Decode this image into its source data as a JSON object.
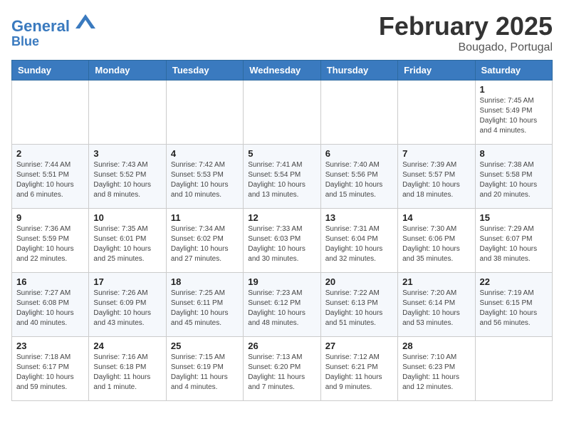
{
  "header": {
    "logo_line1": "General",
    "logo_line2": "Blue",
    "title": "February 2025",
    "subtitle": "Bougado, Portugal"
  },
  "weekdays": [
    "Sunday",
    "Monday",
    "Tuesday",
    "Wednesday",
    "Thursday",
    "Friday",
    "Saturday"
  ],
  "weeks": [
    [
      {
        "day": "",
        "info": ""
      },
      {
        "day": "",
        "info": ""
      },
      {
        "day": "",
        "info": ""
      },
      {
        "day": "",
        "info": ""
      },
      {
        "day": "",
        "info": ""
      },
      {
        "day": "",
        "info": ""
      },
      {
        "day": "1",
        "info": "Sunrise: 7:45 AM\nSunset: 5:49 PM\nDaylight: 10 hours and 4 minutes."
      }
    ],
    [
      {
        "day": "2",
        "info": "Sunrise: 7:44 AM\nSunset: 5:51 PM\nDaylight: 10 hours and 6 minutes."
      },
      {
        "day": "3",
        "info": "Sunrise: 7:43 AM\nSunset: 5:52 PM\nDaylight: 10 hours and 8 minutes."
      },
      {
        "day": "4",
        "info": "Sunrise: 7:42 AM\nSunset: 5:53 PM\nDaylight: 10 hours and 10 minutes."
      },
      {
        "day": "5",
        "info": "Sunrise: 7:41 AM\nSunset: 5:54 PM\nDaylight: 10 hours and 13 minutes."
      },
      {
        "day": "6",
        "info": "Sunrise: 7:40 AM\nSunset: 5:56 PM\nDaylight: 10 hours and 15 minutes."
      },
      {
        "day": "7",
        "info": "Sunrise: 7:39 AM\nSunset: 5:57 PM\nDaylight: 10 hours and 18 minutes."
      },
      {
        "day": "8",
        "info": "Sunrise: 7:38 AM\nSunset: 5:58 PM\nDaylight: 10 hours and 20 minutes."
      }
    ],
    [
      {
        "day": "9",
        "info": "Sunrise: 7:36 AM\nSunset: 5:59 PM\nDaylight: 10 hours and 22 minutes."
      },
      {
        "day": "10",
        "info": "Sunrise: 7:35 AM\nSunset: 6:01 PM\nDaylight: 10 hours and 25 minutes."
      },
      {
        "day": "11",
        "info": "Sunrise: 7:34 AM\nSunset: 6:02 PM\nDaylight: 10 hours and 27 minutes."
      },
      {
        "day": "12",
        "info": "Sunrise: 7:33 AM\nSunset: 6:03 PM\nDaylight: 10 hours and 30 minutes."
      },
      {
        "day": "13",
        "info": "Sunrise: 7:31 AM\nSunset: 6:04 PM\nDaylight: 10 hours and 32 minutes."
      },
      {
        "day": "14",
        "info": "Sunrise: 7:30 AM\nSunset: 6:06 PM\nDaylight: 10 hours and 35 minutes."
      },
      {
        "day": "15",
        "info": "Sunrise: 7:29 AM\nSunset: 6:07 PM\nDaylight: 10 hours and 38 minutes."
      }
    ],
    [
      {
        "day": "16",
        "info": "Sunrise: 7:27 AM\nSunset: 6:08 PM\nDaylight: 10 hours and 40 minutes."
      },
      {
        "day": "17",
        "info": "Sunrise: 7:26 AM\nSunset: 6:09 PM\nDaylight: 10 hours and 43 minutes."
      },
      {
        "day": "18",
        "info": "Sunrise: 7:25 AM\nSunset: 6:11 PM\nDaylight: 10 hours and 45 minutes."
      },
      {
        "day": "19",
        "info": "Sunrise: 7:23 AM\nSunset: 6:12 PM\nDaylight: 10 hours and 48 minutes."
      },
      {
        "day": "20",
        "info": "Sunrise: 7:22 AM\nSunset: 6:13 PM\nDaylight: 10 hours and 51 minutes."
      },
      {
        "day": "21",
        "info": "Sunrise: 7:20 AM\nSunset: 6:14 PM\nDaylight: 10 hours and 53 minutes."
      },
      {
        "day": "22",
        "info": "Sunrise: 7:19 AM\nSunset: 6:15 PM\nDaylight: 10 hours and 56 minutes."
      }
    ],
    [
      {
        "day": "23",
        "info": "Sunrise: 7:18 AM\nSunset: 6:17 PM\nDaylight: 10 hours and 59 minutes."
      },
      {
        "day": "24",
        "info": "Sunrise: 7:16 AM\nSunset: 6:18 PM\nDaylight: 11 hours and 1 minute."
      },
      {
        "day": "25",
        "info": "Sunrise: 7:15 AM\nSunset: 6:19 PM\nDaylight: 11 hours and 4 minutes."
      },
      {
        "day": "26",
        "info": "Sunrise: 7:13 AM\nSunset: 6:20 PM\nDaylight: 11 hours and 7 minutes."
      },
      {
        "day": "27",
        "info": "Sunrise: 7:12 AM\nSunset: 6:21 PM\nDaylight: 11 hours and 9 minutes."
      },
      {
        "day": "28",
        "info": "Sunrise: 7:10 AM\nSunset: 6:23 PM\nDaylight: 11 hours and 12 minutes."
      },
      {
        "day": "",
        "info": ""
      }
    ]
  ]
}
